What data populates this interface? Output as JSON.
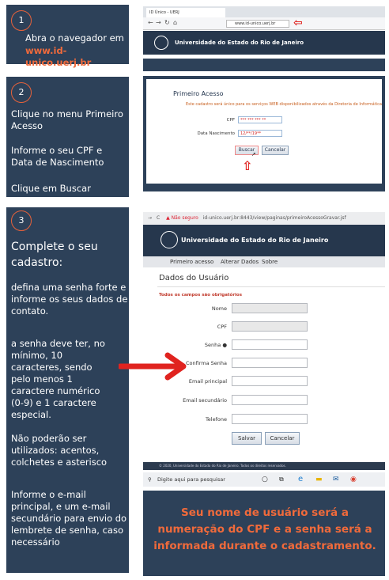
{
  "step1": {
    "number": "1",
    "line1": "Abra o navegador em",
    "link": "www.id-unico.uerj.br"
  },
  "step2": {
    "number": "2",
    "text1": "Clique no menu Primeiro Acesso",
    "text2": "Informe o seu CPF e Data de Nascimento",
    "text3": "Clique em Buscar"
  },
  "step3": {
    "number": "3",
    "heading": "Complete o seu cadastro:",
    "p1": "defina uma senha forte e informe os seus dados de contato.",
    "p2": "a senha deve ter, no mínimo, 10 caracteres, sendo pelo menos 1 caractere numérico (0-9) e 1 caractere especial.",
    "p3": "Não poderão ser utilizados: acentos, colchetes e asterisco",
    "p4": "Informe o e-mail principal, e um e-mail secundário para envio do lembrete de senha, caso necessário"
  },
  "browser1": {
    "tab_title": "ID Único - UERJ",
    "url": "www.id-unico.uerj.br",
    "site_title": "Universidade do Estado do Rio de Janeiro"
  },
  "primeiro_acesso": {
    "title": "Primeiro Acesso",
    "subtitle": "Este cadastro será único para os serviços WEB disponibilizados através da Diretoria de Informática",
    "cpf_label": "CPF",
    "cpf_value": "*** *** *** **",
    "birth_label": "Data Nascimento",
    "birth_value": "12/**/19**",
    "buscar": "Buscar",
    "cancelar": "Cancelar"
  },
  "browser3": {
    "insecure": "Não seguro",
    "url": "id-unico.uerj.br:8443/view/paginas/primeiroAcessoGravar.jsf",
    "site_title": "Universidade do Estado do Rio de Janeiro",
    "menu": [
      "Primeiro acesso",
      "Alterar Dados",
      "Sobre"
    ],
    "section_title": "Dados do Usuário",
    "required_note": "Todos os campos são obrigatórios",
    "labels": [
      "Nome",
      "CPF",
      "Senha",
      "Confirma Senha",
      "Email principal",
      "Email secundário",
      "Telefone"
    ],
    "salvar": "Salvar",
    "cancelar": "Cancelar",
    "footer": "© 2020, Universidade do Estado do Rio de Janeiro. Todos os direitos reservados.",
    "search_placeholder": "Digite aqui para pesquisar"
  },
  "bottom_note": "Seu nome de usuário será a numeração do CPF e a senha será a informada durante o cadastramento.",
  "colors": {
    "panel": "#2d4159",
    "accent": "#f06a3b",
    "arrow": "#e0231f"
  }
}
